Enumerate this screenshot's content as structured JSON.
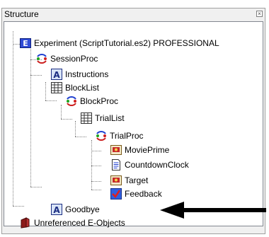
{
  "panel": {
    "title": "Structure",
    "close_glyph": "×"
  },
  "tree": {
    "experiment": "Experiment (ScriptTutorial.es2) PROFESSIONAL",
    "session_proc": "SessionProc",
    "instructions": "Instructions",
    "block_list": "BlockList",
    "block_proc": "BlockProc",
    "trial_list": "TrialList",
    "trial_proc": "TrialProc",
    "movie_prime": "MoviePrime",
    "countdown_clock": "CountdownClock",
    "target": "Target",
    "feedback": "Feedback",
    "goodbye": "Goodbye",
    "unreferenced": "Unreferenced E-Objects"
  },
  "icons": [
    "experiment-icon",
    "procedure-icon",
    "textdisplay-icon",
    "list-icon",
    "slide-icon",
    "inline-icon",
    "feedback-icon",
    "unreferenced-icon"
  ],
  "annotation": {
    "arrow_color": "#000000"
  }
}
